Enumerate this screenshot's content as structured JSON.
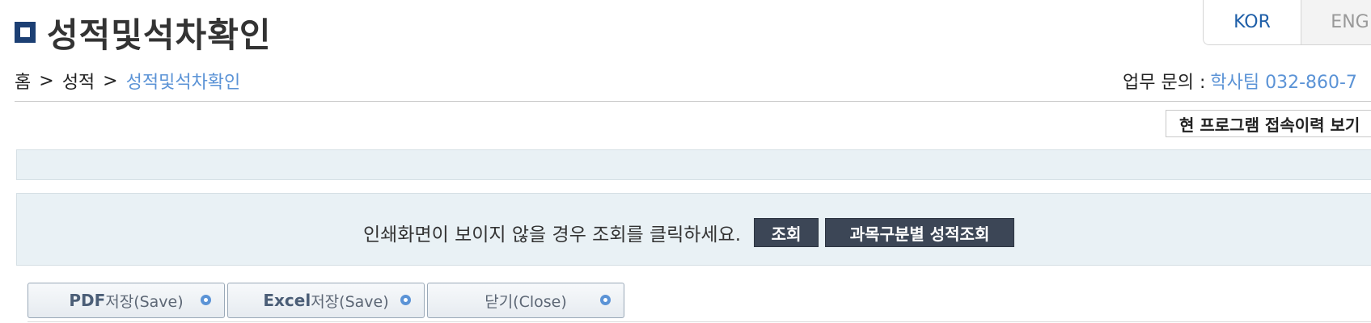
{
  "page": {
    "title": "성적및석차확인"
  },
  "lang": {
    "kor": "KOR",
    "eng": "ENG"
  },
  "breadcrumb": {
    "home": "홈",
    "sep1": ">",
    "level1": "성적",
    "sep2": ">",
    "current": "성적및석차확인"
  },
  "contact": {
    "label": "업무 문의 :",
    "value": "학사팀 032-860-7"
  },
  "history_button": "현 프로그램 접속이력 보기",
  "notice": {
    "text": "인쇄화면이 보이지 않을 경우 조회를 클릭하세요.",
    "search_button": "조회",
    "subject_button": "과목구분별 성적조회"
  },
  "actions": {
    "pdf": {
      "strong": "PDF",
      "light": "저장(Save)"
    },
    "excel": {
      "strong": "Excel",
      "light": "저장(Save)"
    },
    "close": {
      "light": "닫기(Close)"
    }
  },
  "colors": {
    "accent_blue": "#5b93d6",
    "dark_button": "#3c4656",
    "panel_bg": "#e9f1f5",
    "title_icon": "#1c3f73"
  },
  "icons": {
    "title": "square-bullet-icon",
    "action": "circle-arrow-icon"
  }
}
